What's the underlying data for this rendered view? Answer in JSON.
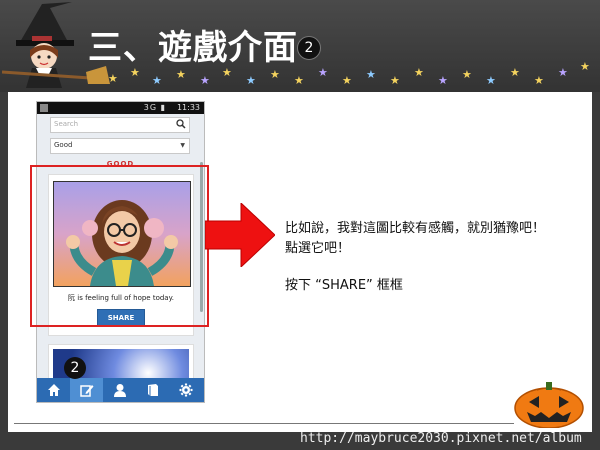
{
  "header": {
    "title": "三、遊戲介面",
    "step_badge": "2"
  },
  "phone": {
    "status_time": "11:33",
    "status_icons": "3G ▮",
    "search_placeholder": "Search",
    "filter_value": "Good",
    "section_label": "GOOD",
    "card_caption": "is feeling full of hope today.",
    "card_caption_prefix": "阮",
    "share_label": "SHARE",
    "nav_items": [
      "home-icon",
      "compose-icon",
      "profile-icon",
      "book-icon",
      "gear-icon"
    ],
    "nav_active_index": 1,
    "nav_step_badge": "2"
  },
  "instructions": {
    "line1": "比如說，我對這圖比較有感觸，就別猶豫吧！",
    "line2": "點選它吧！",
    "line3": "按下 “SHARE” 框框"
  },
  "footer": {
    "url": "http://maybruce2030.pixnet.net/album"
  },
  "colors": {
    "highlight": "#d22222",
    "share_button": "#2f6fb5",
    "nav_bar": "#2c6bb3",
    "arrow": "#ee1111"
  }
}
